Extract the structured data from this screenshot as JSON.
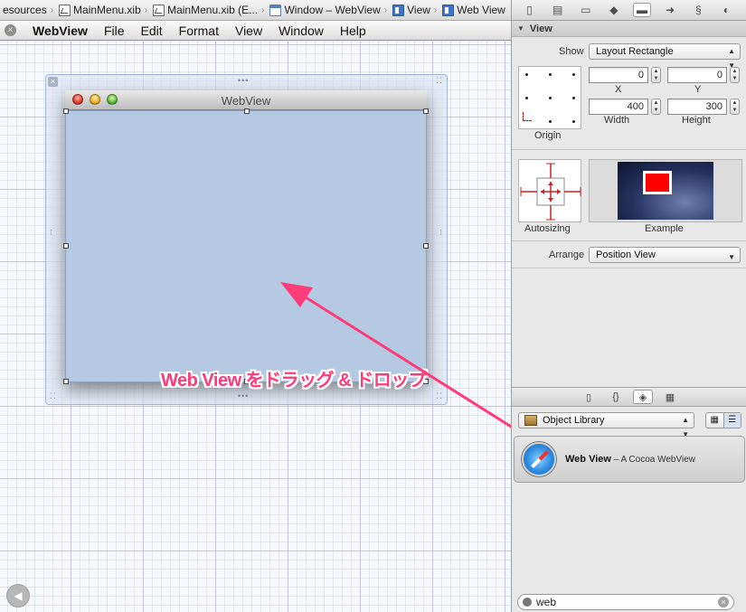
{
  "breadcrumb": [
    {
      "label": "esources",
      "icon": "none"
    },
    {
      "label": "MainMenu.xib",
      "icon": "xib-file-icon"
    },
    {
      "label": "MainMenu.xib (E...",
      "icon": "xib-file-icon"
    },
    {
      "label": "Window – WebView",
      "icon": "window-icon"
    },
    {
      "label": "View",
      "icon": "view-icon"
    },
    {
      "label": "Web View",
      "icon": "view-icon"
    }
  ],
  "doc_menubar": {
    "close": "×",
    "items": [
      "WebView",
      "File",
      "Edit",
      "Format",
      "View",
      "Window",
      "Help"
    ]
  },
  "canvas": {
    "window_title": "WebView",
    "annotation": "Web View をドラッグ & ドロップ",
    "back_button": "◀"
  },
  "inspector": {
    "tabs": [
      "file-icon",
      "quick-help-icon",
      "identity-icon",
      "attributes-icon",
      "size-icon",
      "connections-icon",
      "bindings-icon",
      "effects-icon"
    ],
    "section_title": "View",
    "show_label": "Show",
    "show_value": "Layout Rectangle",
    "x_value": "0",
    "y_value": "0",
    "x_label": "X",
    "y_label": "Y",
    "width_value": "400",
    "height_value": "300",
    "width_label": "Width",
    "height_label": "Height",
    "origin_label": "Origin",
    "autosizing_label": "Autosizing",
    "example_label": "Example",
    "arrange_label": "Arrange",
    "arrange_value": "Position View"
  },
  "library": {
    "tabs": [
      "file-template-icon",
      "code-snippet-icon",
      "object-icon",
      "media-icon"
    ],
    "selector": "Object Library",
    "item_name": "Web View",
    "item_desc": " – A Cocoa WebView",
    "search_value": "web"
  },
  "colors": {
    "accent_annotation": "#ff3b78",
    "webview_fill": "#b6c9e3",
    "example_red": "#ff0000"
  }
}
